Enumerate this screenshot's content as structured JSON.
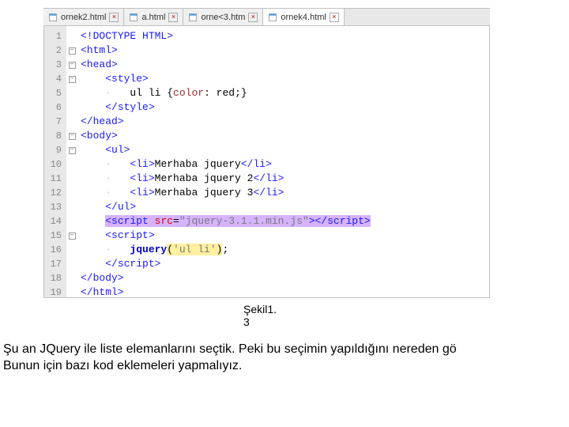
{
  "tabs": [
    {
      "label": "ornek2.html",
      "active": false
    },
    {
      "label": "a.html",
      "active": false
    },
    {
      "label": "orne<3.htm",
      "active": false
    },
    {
      "label": "ornek4.html",
      "active": true
    }
  ],
  "close_glyph": "×",
  "code": {
    "lines": [
      {
        "n": 1,
        "fold": "",
        "html": "<span class='t-doctype'>&lt;!DOCTYPE HTML&gt;</span>"
      },
      {
        "n": 2,
        "fold": "-",
        "html": "<span class='t-tag'>&lt;html&gt;</span>"
      },
      {
        "n": 3,
        "fold": "-",
        "html": "<span class='t-tag'>&lt;head&gt;</span>"
      },
      {
        "n": 4,
        "fold": "-",
        "html": "    <span class='t-tag'>&lt;style&gt;</span>"
      },
      {
        "n": 5,
        "fold": "|",
        "html": "<span class='guide'>    ·   </span><span class='t-sel'>ul li </span><span class='t-text'>{</span><span class='t-prop'>color</span><span class='t-text'>: red;}</span>"
      },
      {
        "n": 6,
        "fold": "",
        "html": "    <span class='t-tag'>&lt;/style&gt;</span>"
      },
      {
        "n": 7,
        "fold": "",
        "html": "<span class='t-tag'>&lt;/head&gt;</span>"
      },
      {
        "n": 8,
        "fold": "-",
        "html": "<span class='t-tag'>&lt;body&gt;</span>"
      },
      {
        "n": 9,
        "fold": "-",
        "html": "    <span class='t-tag'>&lt;ul&gt;</span>"
      },
      {
        "n": 10,
        "fold": "|",
        "html": "<span class='guide'>    ·   </span><span class='t-tag'>&lt;li&gt;</span><span class='t-text'>Merhaba jquery</span><span class='t-tag'>&lt;/li&gt;</span>"
      },
      {
        "n": 11,
        "fold": "|",
        "html": "<span class='guide'>    ·   </span><span class='t-tag'>&lt;li&gt;</span><span class='t-text'>Merhaba jquery 2</span><span class='t-tag'>&lt;/li&gt;</span>"
      },
      {
        "n": 12,
        "fold": "|",
        "html": "<span class='guide'>    ·   </span><span class='t-tag'>&lt;li&gt;</span><span class='t-text'>Merhaba jquery 3</span><span class='t-tag'>&lt;/li&gt;</span>"
      },
      {
        "n": 13,
        "fold": "",
        "html": "    <span class='t-tag'>&lt;/ul&gt;</span>"
      },
      {
        "n": 14,
        "fold": "",
        "html": "    <span class='t-violet'><span class='t-tag'>&lt;script</span> <span class='t-attr'>src</span><span class='t-text'>=</span><span class='t-string'>\"jquery-3.1.1.min.js\"</span><span class='t-tag'>&gt;&lt;/script&gt;</span></span>"
      },
      {
        "n": 15,
        "fold": "-",
        "html": "    <span class='t-tag'>&lt;script&gt;</span>"
      },
      {
        "n": 16,
        "fold": "|",
        "html": "<span class='guide'>    ·   </span><span class='t-kw'>jquery</span><span class='t-yellow'><span class='t-text'>(</span><span class='t-string'>'ul li'</span><span class='t-text'>)</span></span><span class='t-text'>;</span>"
      },
      {
        "n": 17,
        "fold": "",
        "html": "    <span class='t-tag'>&lt;/script&gt;</span>"
      },
      {
        "n": 18,
        "fold": "",
        "html": "<span class='t-tag'>&lt;/body&gt;</span>"
      },
      {
        "n": 19,
        "fold": "",
        "html": "<span class='t-tag'>&lt;/html&gt;</span>"
      }
    ]
  },
  "caption": {
    "line1": "Şekil1.",
    "line2": "3"
  },
  "paragraph": {
    "line1": "Şu an JQuery ile liste elemanlarını seçtik. Peki bu seçimin yapıldığını nereden gö",
    "line2": "Bunun için bazı kod eklemeleri yapmalıyız."
  }
}
